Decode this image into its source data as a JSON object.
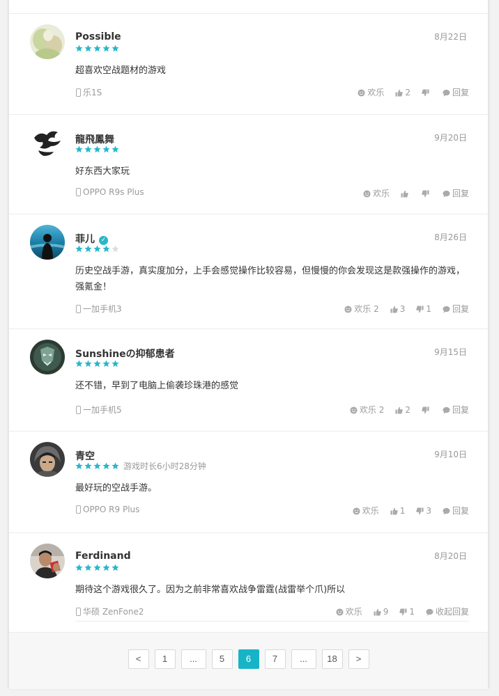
{
  "reviews": [
    {
      "name": "Possible",
      "verified": false,
      "rating": 5,
      "playtime": "",
      "date": "8月22日",
      "text": "超喜欢空战题材的游戏",
      "device": "乐1S",
      "fun_label": "欢乐",
      "fun_count": "",
      "like_count": "2",
      "dislike_count": "",
      "reply_label": "回复"
    },
    {
      "name": "龍飛鳳舞",
      "verified": false,
      "rating": 5,
      "playtime": "",
      "date": "9月20日",
      "text": "好东西大家玩",
      "device": "OPPO R9s Plus",
      "fun_label": "欢乐",
      "fun_count": "",
      "like_count": "",
      "dislike_count": "",
      "reply_label": "回复"
    },
    {
      "name": "菲儿",
      "verified": true,
      "rating": 4,
      "playtime": "",
      "date": "8月26日",
      "text": "历史空战手游，真实度加分，上手会感觉操作比较容易，但慢慢的你会发现这是款强操作的游戏，强氪金！",
      "device": "一加手机3",
      "fun_label": "欢乐",
      "fun_count": "2",
      "like_count": "3",
      "dislike_count": "1",
      "reply_label": "回复"
    },
    {
      "name": "Sunshineの抑郁患者",
      "verified": false,
      "rating": 5,
      "playtime": "",
      "date": "9月15日",
      "text": "还不错，早到了电脑上偷袭珍珠港的感觉",
      "device": "一加手机5",
      "fun_label": "欢乐",
      "fun_count": "2",
      "like_count": "2",
      "dislike_count": "",
      "reply_label": "回复"
    },
    {
      "name": "青空",
      "verified": false,
      "rating": 5,
      "playtime": "游戏时长6小时28分钟",
      "date": "9月10日",
      "text": "最好玩的空战手游。",
      "device": "OPPO R9 Plus",
      "fun_label": "欢乐",
      "fun_count": "",
      "like_count": "1",
      "dislike_count": "3",
      "reply_label": "回复"
    },
    {
      "name": "Ferdinand",
      "verified": false,
      "rating": 5,
      "playtime": "",
      "date": "8月20日",
      "text": "期待这个游戏很久了。因为之前非常喜欢战争雷霆(战雷举个爪)所以",
      "device": "华硕 ZenFone2",
      "fun_label": "欢乐",
      "fun_count": "",
      "like_count": "9",
      "dislike_count": "1",
      "reply_label": "收起回复"
    }
  ],
  "pagination": {
    "prev": "<",
    "items": [
      "1",
      "...",
      "5",
      "6",
      "7",
      "...",
      "18"
    ],
    "current": "6",
    "next": ">"
  },
  "colors": {
    "accent": "#17b4c8",
    "star_on": "#28b7c9",
    "star_off": "#dddddd"
  }
}
